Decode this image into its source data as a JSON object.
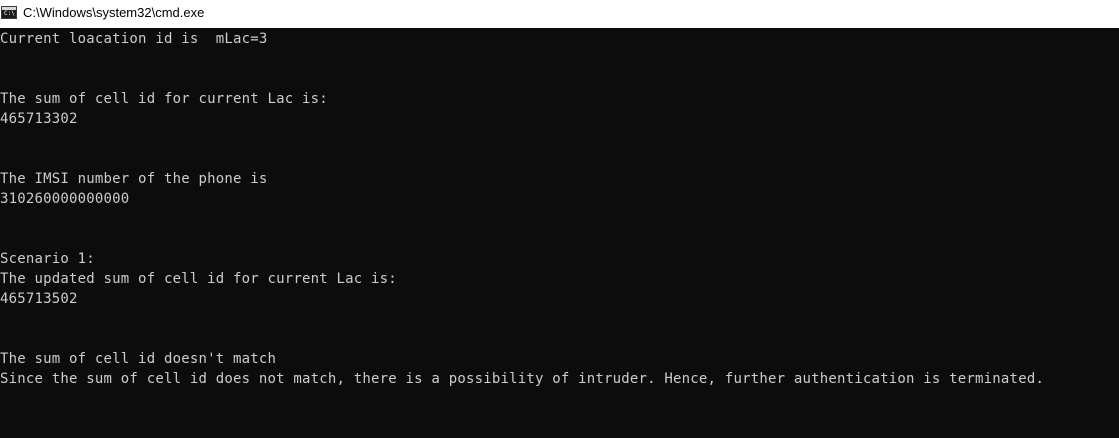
{
  "window": {
    "title": "C:\\Windows\\system32\\cmd.exe",
    "icon": "cmd-icon",
    "icon_prompt": "C:\\"
  },
  "console": {
    "lines": [
      "Current loacation id is  mLac=3",
      "",
      "",
      "The sum of cell id for current Lac is:",
      "465713302",
      "",
      "",
      "The IMSI number of the phone is",
      "310260000000000",
      "",
      "",
      "Scenario 1:",
      "The updated sum of cell id for current Lac is:",
      "465713502",
      "",
      "",
      "The sum of cell id doesn't match",
      "Since the sum of cell id does not match, there is a possibility of intruder. Hence, further authentication is terminated."
    ]
  },
  "colors": {
    "background": "#0c0c0c",
    "text": "#cccccc",
    "titlebar": "#ffffff"
  }
}
